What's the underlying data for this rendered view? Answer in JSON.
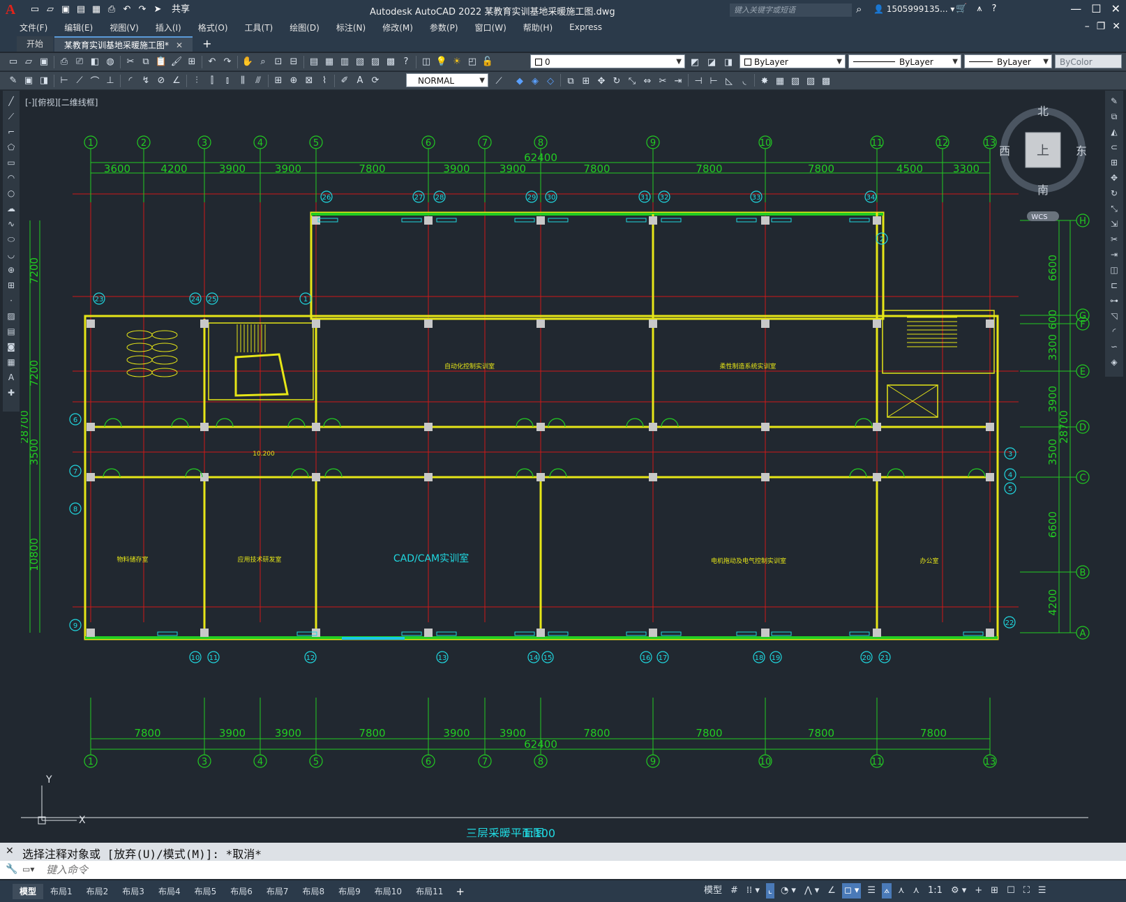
{
  "titlebar": {
    "app_logo": "A",
    "share_label": "共享",
    "title": "Autodesk AutoCAD 2022    某教育实训基地采暖施工图.dwg",
    "search_placeholder": "键入关键字或短语",
    "user": "1505999135...",
    "quick_access_icons": [
      "new-icon",
      "open-icon",
      "save-icon",
      "saveas-icon",
      "publish-icon",
      "plot-icon",
      "undo-icon",
      "redo-icon"
    ]
  },
  "menubar": {
    "items": [
      "文件(F)",
      "编辑(E)",
      "视图(V)",
      "插入(I)",
      "格式(O)",
      "工具(T)",
      "绘图(D)",
      "标注(N)",
      "修改(M)",
      "参数(P)",
      "窗口(W)",
      "帮助(H)",
      "Express"
    ]
  },
  "tabs": {
    "start": "开始",
    "active": "某教育实训基地采暖施工图*"
  },
  "toolbar1": {
    "layer_value": "0",
    "color_value": "ByLayer",
    "linetype_value": "ByLayer",
    "lineweight_value": "ByLayer",
    "plotstyle_value": "ByColor"
  },
  "toolbar2": {
    "dimstyle_value": "NORMAL"
  },
  "viewport": {
    "label": "[-][俯视][二维线框]"
  },
  "viewcube": {
    "north": "北",
    "south": "南",
    "east": "东",
    "west": "西",
    "top": "上",
    "wcs": "WCS"
  },
  "ucs": {
    "x": "X",
    "y": "Y"
  },
  "drawing": {
    "title": "三层采暖平面图",
    "scale": "1:100",
    "total_width": "62400",
    "total_height": "28700",
    "top_axes": [
      "1",
      "2",
      "3",
      "4",
      "5",
      "6",
      "7",
      "8",
      "9",
      "10",
      "11",
      "12",
      "13"
    ],
    "top_dims": [
      "3600",
      "4200",
      "3900",
      "3900",
      "7800",
      "3900",
      "3900",
      "7800",
      "7800",
      "7800",
      "4500",
      "3300"
    ],
    "bottom_axes": [
      "1",
      "3",
      "4",
      "5",
      "6",
      "7",
      "8",
      "9",
      "10",
      "11",
      "13"
    ],
    "bottom_dims": [
      "7800",
      "3900",
      "3900",
      "7800",
      "3900",
      "3900",
      "7800",
      "7800",
      "7800",
      "7800"
    ],
    "right_axes": [
      "H",
      "G",
      "F",
      "E",
      "D",
      "C",
      "B",
      "A"
    ],
    "right_dims": [
      "6600",
      "600",
      "3300",
      "3900",
      "3500",
      "6600",
      "4200"
    ],
    "left_dims": [
      "7200",
      "7200",
      "3500",
      "10800"
    ],
    "left_partial_total": "28700",
    "rooms": [
      "自动化控制实训室",
      "柔性制造系统实训室",
      "物料储存室",
      "应用技术研发室",
      "CAD/CAM实训室",
      "电机拖动及电气控制实训室",
      "办公室"
    ],
    "elevation": "10.200",
    "radiator_tags": [
      "1",
      "2",
      "3",
      "4",
      "5",
      "6",
      "7",
      "8",
      "9",
      "10",
      "11",
      "12",
      "13",
      "14",
      "15",
      "16",
      "17",
      "18",
      "19",
      "20",
      "21",
      "22",
      "23",
      "24",
      "25",
      "26",
      "27",
      "28",
      "29",
      "30",
      "31",
      "32",
      "33",
      "34"
    ]
  },
  "command": {
    "history": "选择注释对象或 [放弃(U)/模式(M)]: *取消*",
    "placeholder": "键入命令"
  },
  "statusbar": {
    "layout_tabs": [
      "模型",
      "布局1",
      "布局2",
      "布局3",
      "布局4",
      "布局5",
      "布局6",
      "布局7",
      "布局8",
      "布局9",
      "布局10",
      "布局11"
    ],
    "model_label": "模型",
    "scale_label": "1:1"
  },
  "colors": {
    "background": "#212830",
    "axis_line": "#d01818",
    "dimension": "#22cc22",
    "wall": "#e6e617",
    "tag": "#20d8e0",
    "ui_chrome": "#2b3a4a"
  }
}
